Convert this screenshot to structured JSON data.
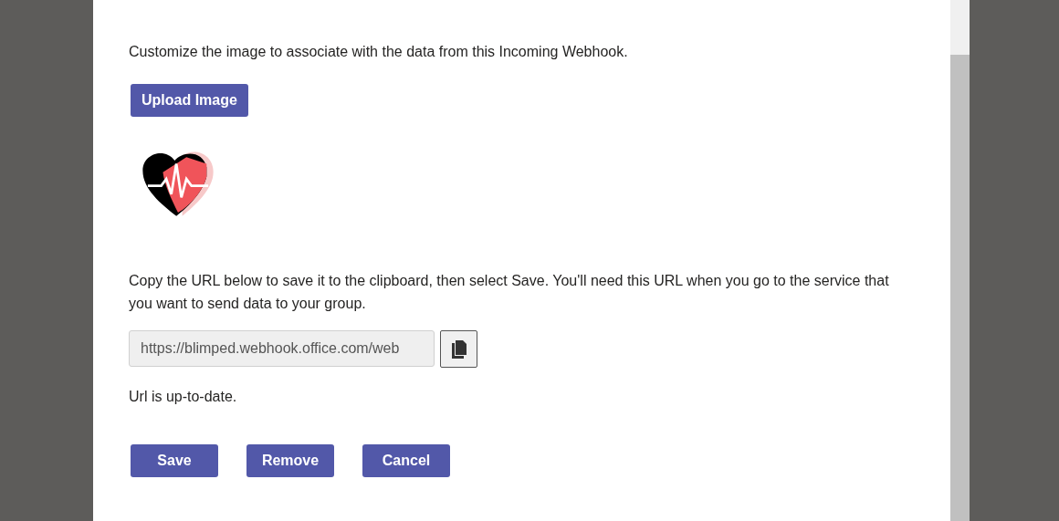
{
  "dialog": {
    "image_instruction": "Customize the image to associate with the data from this Incoming Webhook.",
    "upload_button": "Upload Image",
    "url_instruction": "Copy the URL below to save it to the clipboard, then select Save. You'll need this URL when you go to the service that you want to send data to your group.",
    "url_field": {
      "value": "https://blimped.webhook.office.com/web",
      "disabled": true
    },
    "status": "Url is up-to-date.",
    "buttons": [
      "Save",
      "Remove",
      "Cancel"
    ]
  }
}
